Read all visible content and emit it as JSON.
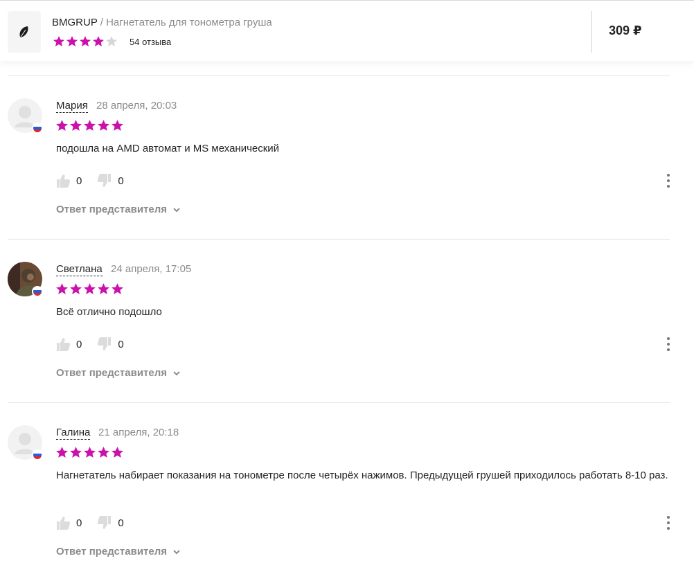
{
  "header": {
    "brand": "BMGRUP",
    "separator": " / ",
    "product_name": "Нагнетатель для тонометра груша",
    "rating": 4,
    "max_rating": 5,
    "reviews_count": "54 отзыва",
    "price": "309 ₽",
    "star_color": "#cb11ab",
    "star_empty_color": "#d7d7d7"
  },
  "reviews": [
    {
      "author": "Мария",
      "date": "28 апреля, 20:03",
      "rating": 5,
      "text": "подошла на AMD автомат и MS механический",
      "likes": "0",
      "dislikes": "0",
      "reply_label": "Ответ представителя",
      "avatar": "default-avatar"
    },
    {
      "author": "Светлана",
      "date": "24 апреля, 17:05",
      "rating": 5,
      "text": "Всё отлично подошло",
      "likes": "0",
      "dislikes": "0",
      "reply_label": "Ответ представителя",
      "avatar": "photo-avatar"
    },
    {
      "author": "Галина",
      "date": "21 апреля, 20:18",
      "rating": 5,
      "text": "Нагнетатель набирает показания на тонометре после четырёх нажимов. Предыдущей грушей приходилось работать 8-10 раз.",
      "likes": "0",
      "dislikes": "0",
      "reply_label": "Ответ представителя",
      "avatar": "default-avatar"
    }
  ]
}
